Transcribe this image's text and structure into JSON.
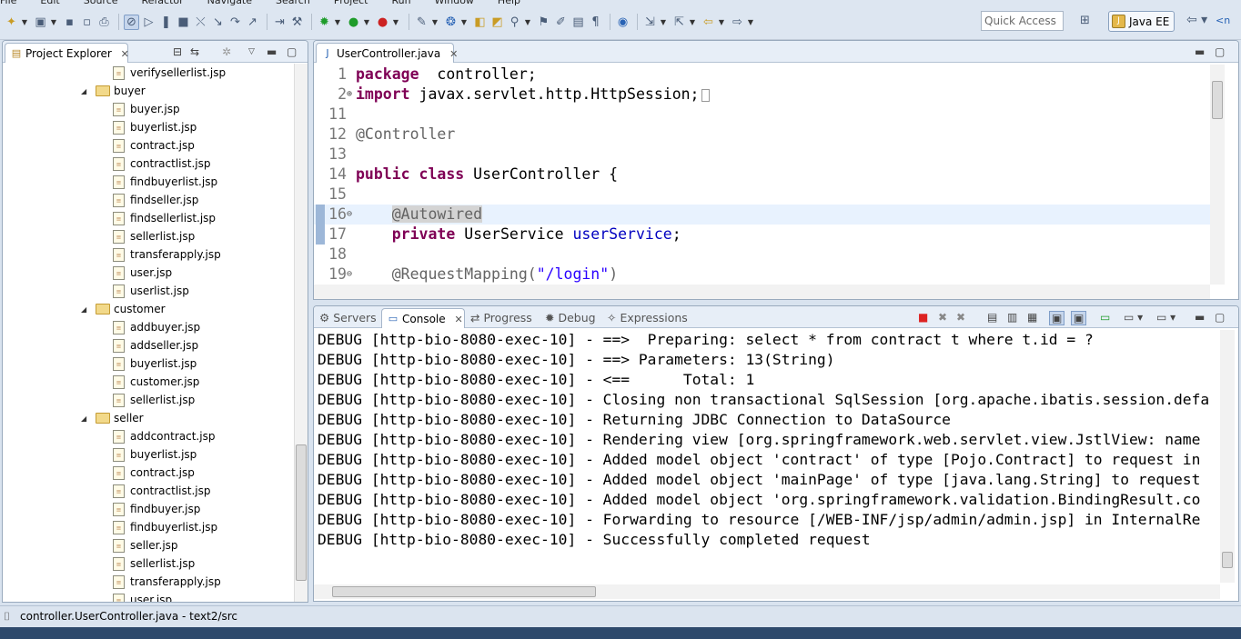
{
  "menu": [
    "File",
    "Edit",
    "Source",
    "Refactor",
    "Navigate",
    "Search",
    "Project",
    "Run",
    "Window",
    "Help"
  ],
  "quick_access": {
    "placeholder": "Quick Access"
  },
  "perspective": {
    "label": "Java EE"
  },
  "explorer": {
    "tab_label": "Project Explorer",
    "items": [
      {
        "label": "verifysellerlist.jsp",
        "kind": "file",
        "depth": 2
      },
      {
        "label": "buyer",
        "kind": "folder",
        "depth": 1
      },
      {
        "label": "buyer.jsp",
        "kind": "file",
        "depth": 2
      },
      {
        "label": "buyerlist.jsp",
        "kind": "file",
        "depth": 2
      },
      {
        "label": "contract.jsp",
        "kind": "file",
        "depth": 2
      },
      {
        "label": "contractlist.jsp",
        "kind": "file",
        "depth": 2
      },
      {
        "label": "findbuyerlist.jsp",
        "kind": "file",
        "depth": 2
      },
      {
        "label": "findseller.jsp",
        "kind": "file",
        "depth": 2
      },
      {
        "label": "findsellerlist.jsp",
        "kind": "file",
        "depth": 2
      },
      {
        "label": "sellerlist.jsp",
        "kind": "file",
        "depth": 2
      },
      {
        "label": "transferapply.jsp",
        "kind": "file",
        "depth": 2
      },
      {
        "label": "user.jsp",
        "kind": "file",
        "depth": 2
      },
      {
        "label": "userlist.jsp",
        "kind": "file",
        "depth": 2
      },
      {
        "label": "customer",
        "kind": "folder",
        "depth": 1
      },
      {
        "label": "addbuyer.jsp",
        "kind": "file",
        "depth": 2
      },
      {
        "label": "addseller.jsp",
        "kind": "file",
        "depth": 2
      },
      {
        "label": "buyerlist.jsp",
        "kind": "file",
        "depth": 2
      },
      {
        "label": "customer.jsp",
        "kind": "file",
        "depth": 2
      },
      {
        "label": "sellerlist.jsp",
        "kind": "file",
        "depth": 2
      },
      {
        "label": "seller",
        "kind": "folder",
        "depth": 1
      },
      {
        "label": "addcontract.jsp",
        "kind": "file",
        "depth": 2
      },
      {
        "label": "buyerlist.jsp",
        "kind": "file",
        "depth": 2
      },
      {
        "label": "contract.jsp",
        "kind": "file",
        "depth": 2
      },
      {
        "label": "contractlist.jsp",
        "kind": "file",
        "depth": 2
      },
      {
        "label": "findbuyer.jsp",
        "kind": "file",
        "depth": 2
      },
      {
        "label": "findbuyerlist.jsp",
        "kind": "file",
        "depth": 2
      },
      {
        "label": "seller.jsp",
        "kind": "file",
        "depth": 2
      },
      {
        "label": "sellerlist.jsp",
        "kind": "file",
        "depth": 2
      },
      {
        "label": "transferapply.jsp",
        "kind": "file",
        "depth": 2
      },
      {
        "label": "user.jsp",
        "kind": "file",
        "depth": 2
      }
    ]
  },
  "editor": {
    "tab_label": "UserController.java",
    "lines": [
      {
        "n": "1",
        "parts": [
          [
            "kw",
            "package"
          ],
          [
            "",
            "  controller;"
          ]
        ]
      },
      {
        "n": "2",
        "parts": [
          [
            "kw",
            "import"
          ],
          [
            "",
            " javax.servlet.http.HttpSession;"
          ]
        ]
      },
      {
        "n": "11",
        "parts": []
      },
      {
        "n": "12",
        "parts": [
          [
            "an",
            "@Controller"
          ]
        ]
      },
      {
        "n": "13",
        "parts": []
      },
      {
        "n": "14",
        "parts": [
          [
            "kw",
            "public"
          ],
          [
            "",
            " "
          ],
          [
            "kw",
            "class"
          ],
          [
            "",
            " UserController {"
          ]
        ]
      },
      {
        "n": "15",
        "parts": []
      },
      {
        "n": "16",
        "parts": [
          [
            "",
            "    "
          ],
          [
            "an",
            "@Autowired"
          ]
        ]
      },
      {
        "n": "17",
        "parts": [
          [
            "",
            "    "
          ],
          [
            "kw",
            "private"
          ],
          [
            "",
            " UserService "
          ],
          [
            "fd",
            "userService"
          ],
          [
            "",
            ";"
          ]
        ]
      },
      {
        "n": "18",
        "parts": []
      },
      {
        "n": "19",
        "parts": [
          [
            "",
            "    "
          ],
          [
            "an",
            "@RequestMapping("
          ],
          [
            "st",
            "\"/login\""
          ],
          [
            "an",
            ")"
          ]
        ]
      }
    ]
  },
  "bottom_tabs": [
    "Servers",
    "Console",
    "Progress",
    "Debug",
    "Expressions"
  ],
  "console_lines": [
    "DEBUG [http-bio-8080-exec-10] - ==>  Preparing: select * from contract t where t.id = ?",
    "DEBUG [http-bio-8080-exec-10] - ==> Parameters: 13(String)",
    "DEBUG [http-bio-8080-exec-10] - <==      Total: 1",
    "DEBUG [http-bio-8080-exec-10] - Closing non transactional SqlSession [org.apache.ibatis.session.defa",
    "DEBUG [http-bio-8080-exec-10] - Returning JDBC Connection to DataSource",
    "DEBUG [http-bio-8080-exec-10] - Rendering view [org.springframework.web.servlet.view.JstlView: name",
    "DEBUG [http-bio-8080-exec-10] - Added model object 'contract' of type [Pojo.Contract] to request in",
    "DEBUG [http-bio-8080-exec-10] - Added model object 'mainPage' of type [java.lang.String] to request",
    "DEBUG [http-bio-8080-exec-10] - Added model object 'org.springframework.validation.BindingResult.co",
    "DEBUG [http-bio-8080-exec-10] - Forwarding to resource [/WEB-INF/jsp/admin/admin.jsp] in InternalRe",
    "DEBUG [http-bio-8080-exec-10] - Successfully completed request"
  ],
  "status": {
    "text": "controller.UserController.java - text2/src"
  },
  "colors": {
    "keyword": "#7f0055",
    "annotation": "#646464",
    "string": "#2a00ff",
    "field": "#0000c0"
  }
}
